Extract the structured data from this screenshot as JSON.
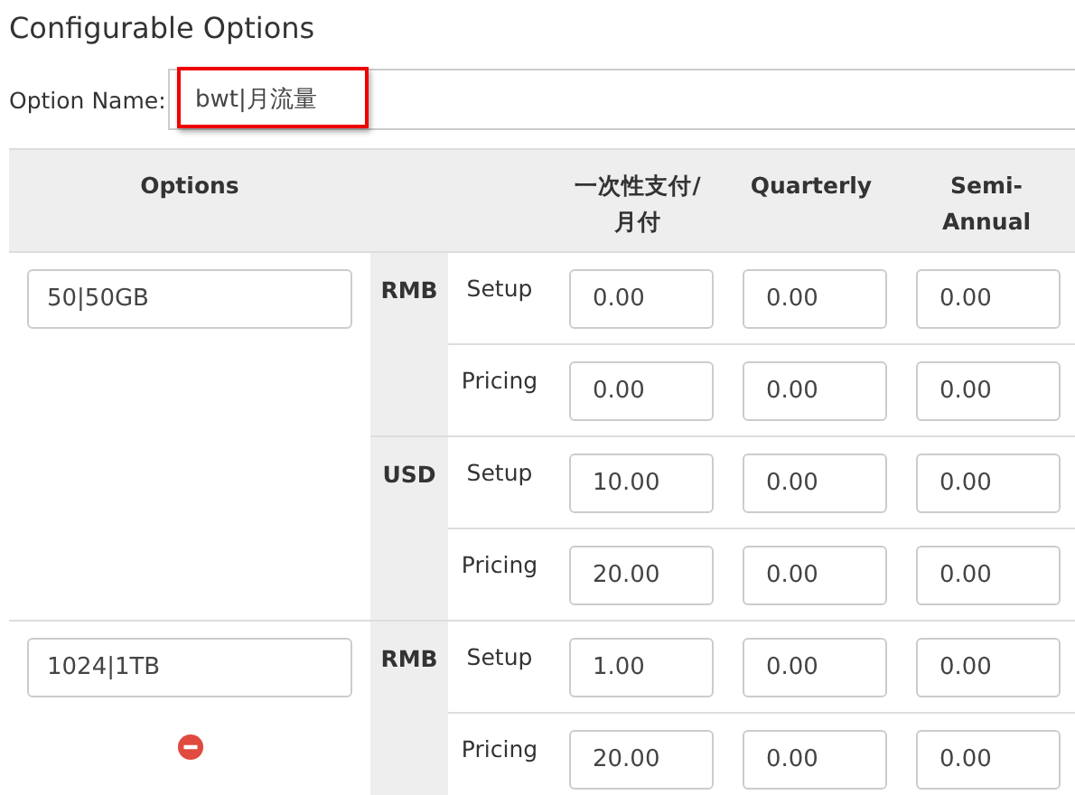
{
  "title": "Configurable Options",
  "option_name": {
    "label": "Option Name:",
    "value": "bwt|月流量",
    "highlighted": true
  },
  "table": {
    "columns": [
      "Options",
      "一次性支付/月付",
      "Quarterly",
      "Semi-Annual"
    ],
    "options": [
      {
        "value": "50|50GB",
        "removable": false,
        "currencies": [
          {
            "code": "RMB",
            "rows": [
              {
                "label": "Setup",
                "values": [
                  "0.00",
                  "0.00",
                  "0.00"
                ]
              },
              {
                "label": "Pricing",
                "values": [
                  "0.00",
                  "0.00",
                  "0.00"
                ]
              }
            ]
          },
          {
            "code": "USD",
            "rows": [
              {
                "label": "Setup",
                "values": [
                  "10.00",
                  "0.00",
                  "0.00"
                ]
              },
              {
                "label": "Pricing",
                "values": [
                  "20.00",
                  "0.00",
                  "0.00"
                ]
              }
            ]
          }
        ]
      },
      {
        "value": "1024|1TB",
        "removable": true,
        "currencies": [
          {
            "code": "RMB",
            "rows": [
              {
                "label": "Setup",
                "values": [
                  "1.00",
                  "0.00",
                  "0.00"
                ]
              },
              {
                "label": "Pricing",
                "values": [
                  "20.00",
                  "0.00",
                  "0.00"
                ]
              }
            ]
          }
        ]
      }
    ]
  }
}
